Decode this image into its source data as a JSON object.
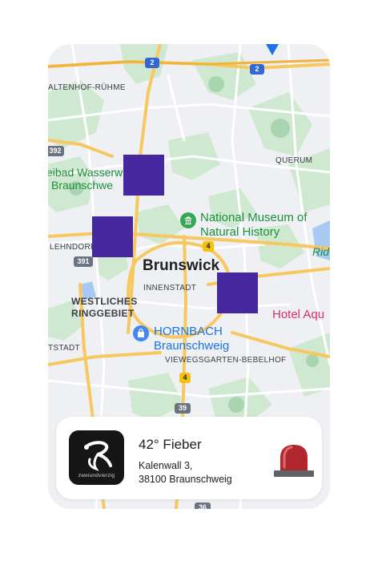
{
  "map": {
    "labels": {
      "altenhof": "ALTENHOF-RÜHME",
      "querum": "QUERUM",
      "freibad_line1": "eibad Wasserw",
      "freibad_line2": "Braunschwe",
      "museum_line1": "National Museum of",
      "museum_line2": "Natural History",
      "lehndorf": "LEHNDORF",
      "city": "Brunswick",
      "innenstadt": "INNENSTADT",
      "westliches_line1": "WESTLICHES",
      "westliches_line2": "RINGGEBIET",
      "hornbach_line1": "HORNBACH",
      "hornbach_line2": "Braunschweig",
      "hotel": "Hotel Aqu",
      "rid": "Rid",
      "weststadt": "TSTADT",
      "viewegsgarten": "VIEWEGSGARTEN-BEBELHOF"
    },
    "shields": {
      "a2_top": "2",
      "a2_right": "2",
      "b392": "392",
      "b391": "391",
      "b4_center": "4",
      "b4_south": "4",
      "a39": "39",
      "a36": "36"
    },
    "marker_count": 3
  },
  "info_card": {
    "logo_text": "zweiundvierzig",
    "title": "42° Fieber",
    "address_line1": "Kalenwall 3,",
    "address_line2": "38100 Braunschweig",
    "alert_icon": "siren-icon"
  },
  "colors": {
    "marker": "#4527a0",
    "park": "#c8e6c9",
    "road_major": "#f6c85f",
    "road_minor": "#ffffff",
    "map_bg": "#eef0f3",
    "siren_red": "#b2262d"
  }
}
